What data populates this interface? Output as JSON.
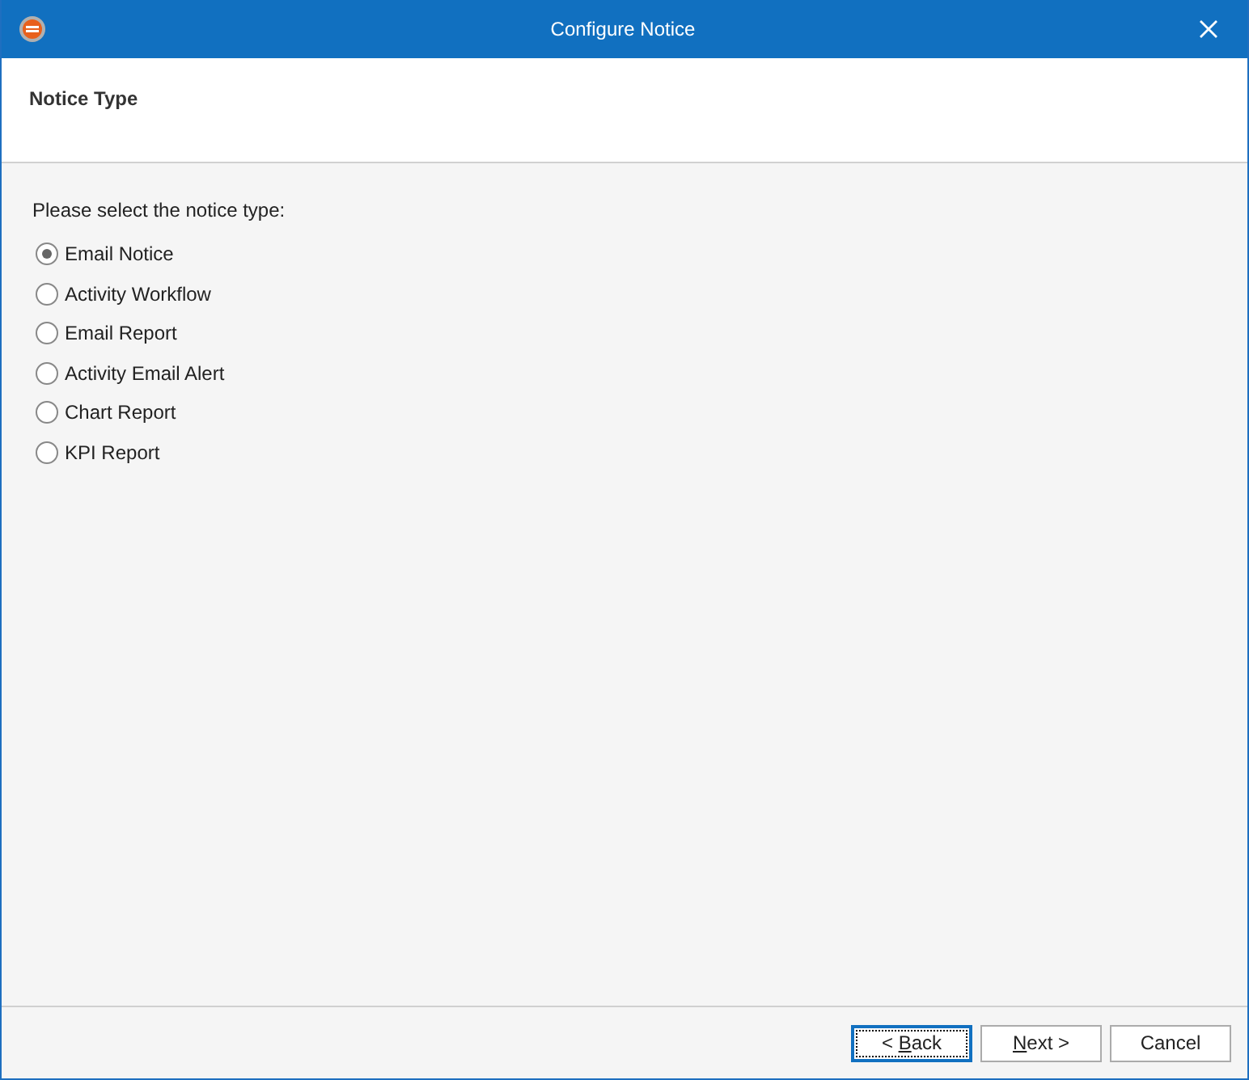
{
  "window": {
    "title": "Configure Notice"
  },
  "header": {
    "title": "Notice Type"
  },
  "prompt": "Please select the notice type:",
  "options": [
    {
      "label": "Email Notice",
      "selected": true
    },
    {
      "label": "Activity Workflow",
      "selected": false
    },
    {
      "label": "Email Report",
      "selected": false
    },
    {
      "label": "Activity Email Alert",
      "selected": false
    },
    {
      "label": "Chart Report",
      "selected": false
    },
    {
      "label": "KPI Report",
      "selected": false
    }
  ],
  "buttons": [
    {
      "before": "< ",
      "key": "B",
      "after": "ack",
      "focused": true
    },
    {
      "key": "N",
      "after": "ext >",
      "focused": false
    },
    {
      "before": "Cancel",
      "focused": false
    }
  ]
}
